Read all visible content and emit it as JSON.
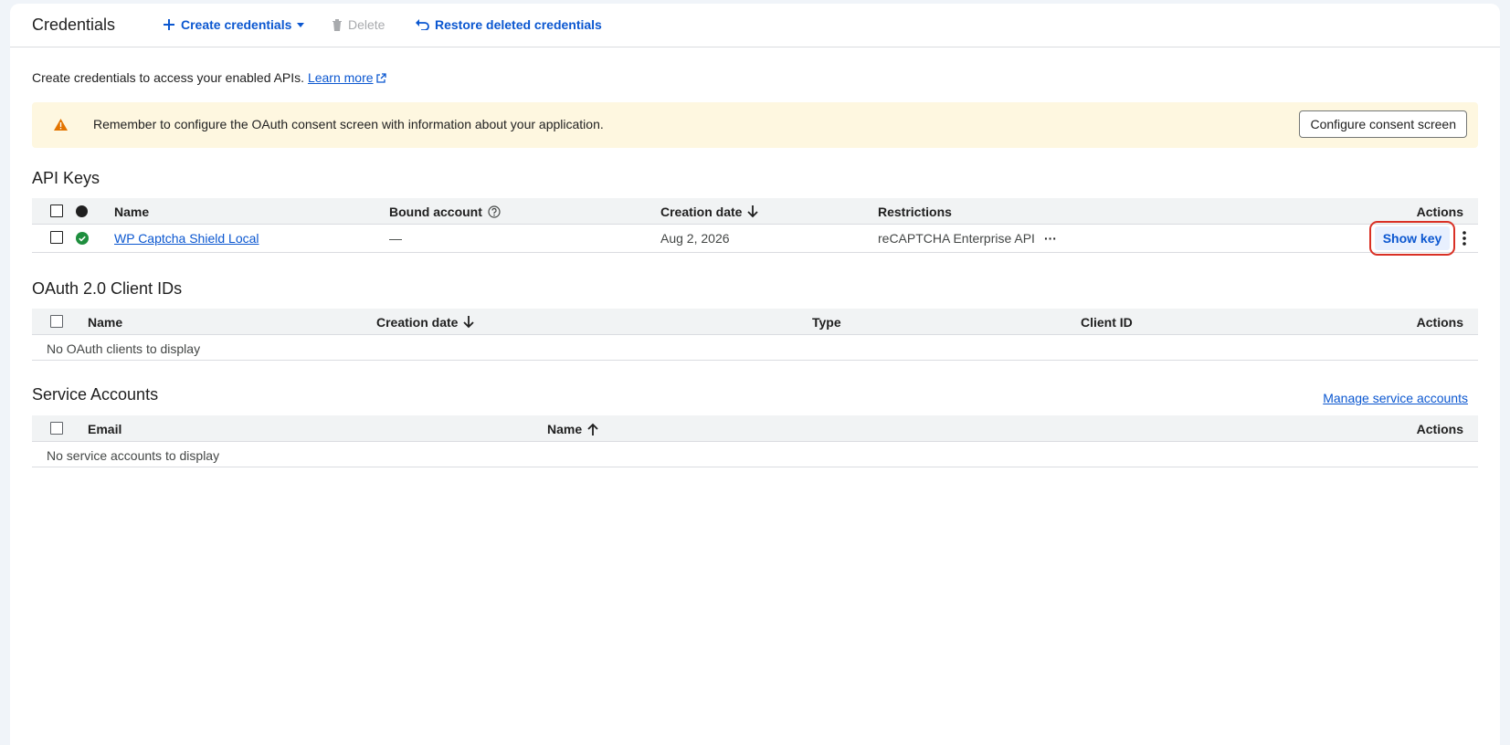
{
  "toolbar": {
    "title": "Credentials",
    "create_label": "Create credentials",
    "delete_label": "Delete",
    "restore_label": "Restore deleted credentials"
  },
  "intro": {
    "text": "Create credentials to access your enabled APIs.",
    "learn_more": "Learn more"
  },
  "banner": {
    "text": "Remember to configure the OAuth consent screen with information about your application.",
    "button": "Configure consent screen"
  },
  "api_keys": {
    "title": "API Keys",
    "columns": [
      "Name",
      "Bound account",
      "Creation date",
      "Restrictions",
      "Actions"
    ],
    "rows": [
      {
        "name": "WP Captcha Shield Local",
        "bound_account": "—",
        "creation_date": "Aug 2, 2026",
        "restrictions": "reCAPTCHA Enterprise API",
        "more": "···",
        "action": "Show key"
      }
    ]
  },
  "oauth": {
    "title": "OAuth 2.0 Client IDs",
    "columns": [
      "Name",
      "Creation date",
      "Type",
      "Client ID",
      "Actions"
    ],
    "empty": "No OAuth clients to display"
  },
  "service_accounts": {
    "title": "Service Accounts",
    "manage_link": "Manage service accounts",
    "columns": [
      "Email",
      "Name",
      "Actions"
    ],
    "empty": "No service accounts to display"
  },
  "colors": {
    "accent": "#0b57d0",
    "warning": "#e37400",
    "success": "#1e8e3e",
    "banner_bg": "#fef7e0"
  }
}
